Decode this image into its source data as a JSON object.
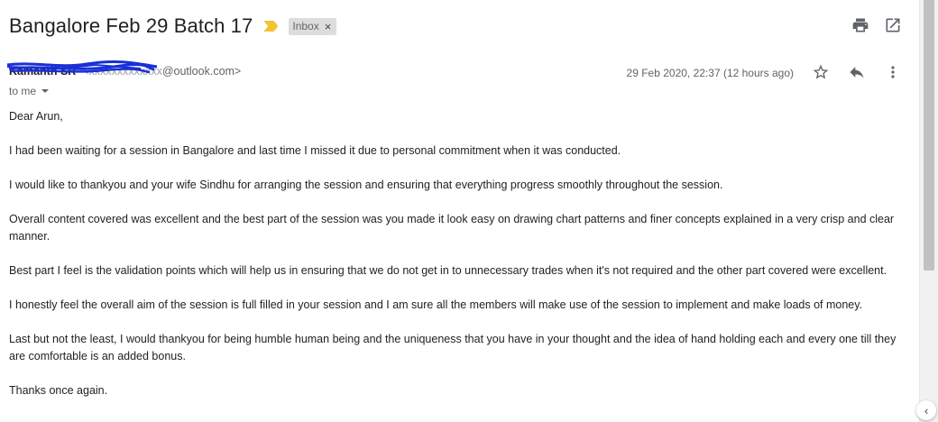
{
  "email": {
    "subject": "Bangalore Feb 29 Batch 17",
    "label": "Inbox",
    "label_remove": "×",
    "sender": {
      "name": "Kamanth SR",
      "email_visible": "@outlook.com>"
    },
    "date": "29 Feb 2020, 22:37 (12 hours ago)",
    "to": "to me",
    "body": [
      "Dear Arun,",
      "I had been waiting for a session in Bangalore and last time I missed it due to personal commitment when it was conducted.",
      "I would like to thankyou and your wife Sindhu for arranging the session and ensuring that everything progress smoothly throughout the session.",
      "Overall content covered was excellent and the best part of the session was you made it look easy on drawing chart patterns and finer concepts explained in a very crisp and clear manner.",
      "Best part I feel is the validation points which will help us in ensuring that we do not get in to unnecessary trades when it's not required and the other part covered were excellent.",
      "I honestly feel the overall aim of the session is full filled in your session and I am sure all the members will make use of the session to implement and make loads of money.",
      "Last but not the least, I would thankyou for being humble human being and the uniqueness that you have in your thought and the idea of hand holding each and every one till they are comfortable is an added bonus.",
      "Thanks once again."
    ]
  },
  "icons": {
    "print": "print-icon",
    "open_new": "open-in-new-icon",
    "star": "star-icon",
    "reply": "reply-icon",
    "more": "more-vert-icon",
    "importance": "importance-marker-icon"
  },
  "colors": {
    "label_bg": "#dddddd",
    "importance": "#f4c430",
    "scribble": "#1a2fd6"
  },
  "corner_button": "‹"
}
